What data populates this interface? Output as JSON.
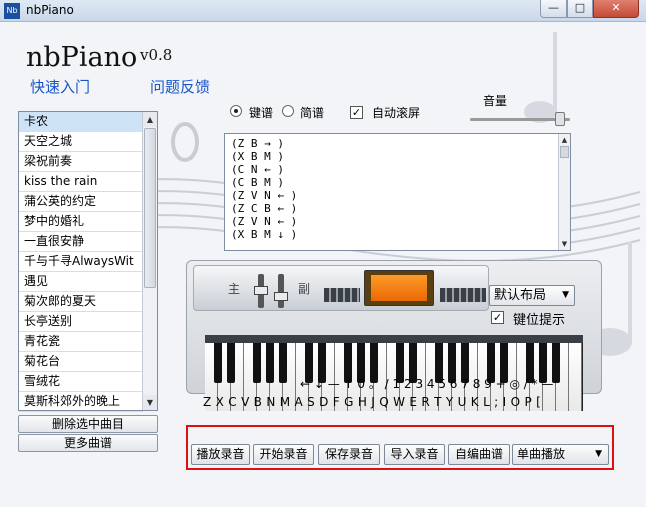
{
  "window": {
    "title": "nbPiano",
    "icon_text": "Nb"
  },
  "header": {
    "logo": "nbPiano",
    "version": "v0.8",
    "links": {
      "quick_start": "快速入门",
      "feedback": "问题反馈"
    }
  },
  "songs": {
    "items": [
      "卡农",
      "天空之城",
      "梁祝前奏",
      "kiss the rain",
      "蒲公英的约定",
      "梦中的婚礼",
      "一直很安静",
      "千与千寻AlwaysWit",
      "遇见",
      "菊次郎的夏天",
      "长亭送别",
      "青花瓷",
      "菊花台",
      "雪绒花",
      "莫斯科郊外的晚上"
    ],
    "selected_index": 0
  },
  "buttons": {
    "delete_selected": "删除选中曲目",
    "more_songs": "更多曲谱"
  },
  "options": {
    "key_score": "键谱",
    "simple_score": "简谱",
    "auto_scroll": "自动滚屏",
    "auto_scroll_checked": "✓",
    "volume": "音量"
  },
  "score": {
    "lines": [
      "(Z B → )",
      "(X B M )",
      "(C N ← )",
      "(C B M )",
      "(Z V N ← )",
      "(Z C B ← )",
      "(Z V N ← )",
      "(X B M ↓ )"
    ]
  },
  "keyboard_panel": {
    "main_label": "主",
    "sub_label": "副",
    "layout_select": "默认布局",
    "show_keys_label": "键位提示",
    "show_keys_checked": "✓",
    "keymap_row1": "← ↓ — ↑ 0 。 / 1 2 3 4 5 6 7 8 9 + ◎ / * —",
    "keymap_row2": "Z X C V B N M A S D F G H J Q W E R T Y U K L ; I O P ["
  },
  "toolbar": {
    "play_recording": "播放录音",
    "start_recording": "开始录音",
    "save_recording": "保存录音",
    "import_recording": "导入录音",
    "self_compose": "自编曲谱",
    "play_mode": "单曲播放"
  }
}
